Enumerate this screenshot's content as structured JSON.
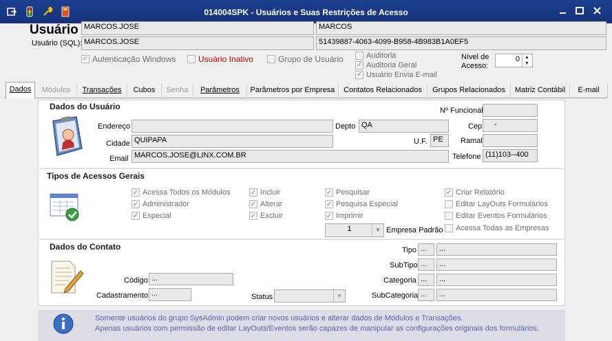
{
  "window": {
    "title": "014004SPK - Usuários e Suas Restrições de Acesso"
  },
  "header": {
    "usuario_label": "Usuário",
    "usuario_sql_label": "Usuário (SQL):",
    "login": "MARCOS.JOSE",
    "name": "MARCOS",
    "sql_login": "MARCOS.JOSE",
    "guid": "51439887-4063-4099-B958-4B983B1A0EF5",
    "auth_windows": "Autenticação Windows",
    "usuario_inativo": "Usuário Inativo",
    "grupo_usuario": "Grupo de Usuário",
    "auditoria": "Auditoria",
    "auditoria_geral": "Auditoria Geral",
    "usuario_envia_email": "Usuário Envia E-mail",
    "nivel_acesso_label_1": "Nível de",
    "nivel_acesso_label_2": "Acesso:",
    "nivel_acesso_value": "0"
  },
  "tabs": [
    {
      "label": "Dados"
    },
    {
      "label": "Módulos"
    },
    {
      "label": "Transações"
    },
    {
      "label": "Cubos"
    },
    {
      "label": "Senha"
    },
    {
      "label": "Parâmetros"
    },
    {
      "label": "Parâmetros por Empresa"
    },
    {
      "label": "Contatos Relacionados"
    },
    {
      "label": "Grupos Relacionados"
    },
    {
      "label": "Matriz Contábil"
    },
    {
      "label": "E-mail"
    }
  ],
  "dados_usuario": {
    "title": "Dados do Usuário",
    "n_funcional_label": "Nº Funcional",
    "endereco_label": "Endereço",
    "depto_label": "Depto",
    "depto_value": "QA",
    "cep_label": "Cep",
    "cep_value": "-",
    "cidade_label": "Cidade",
    "cidade_value": "QUIPAPA",
    "uf_label": "U.F.",
    "uf_value": "PE",
    "ramal_label": "Ramal",
    "email_label": "Email",
    "email_value": "MARCOS.JOSE@LINX.COM.BR",
    "telefone_label": "Telefone",
    "telefone_value": "(11)103--400"
  },
  "acessos": {
    "title": "Tipos de Acessos Gerais",
    "items": [
      "Acessa Todos os Módulos",
      "Administrador",
      "Especial",
      "Incluir",
      "Alterar",
      "Excluir",
      "Pesquisar",
      "Pesquisa Especial",
      "Imprimir",
      "Criar Relatório",
      "Editar LayOuts Formulários",
      "Editar Eventos Formulários",
      "Acessa Todas as Empresas"
    ],
    "empresa_padrao_value": "1",
    "empresa_padrao_label": "Empresa Padrão"
  },
  "contato": {
    "title": "Dados do Contato",
    "tipo_label": "Tipo",
    "subtipo_label": "SubTipo",
    "categoria_label": "Categoria",
    "subcategoria_label": "SubCategoria",
    "codigo_label": "Código",
    "cadastramento_label": "Cadastramento",
    "status_label": "Status",
    "ellipsis": "..."
  },
  "info": {
    "line1": "Somente usuários do grupo SysAdmin podem criar novos usuários e alterar dados de Módulos e Transações.",
    "line2": "Apenas usuários com permissão de editar LayOuts/Eventos serão capazes de manipular as configurações originais dos formulários."
  },
  "colors": {
    "titlebar": "#1c3f8e",
    "info_text": "#5a63b8",
    "inactive_red": "#c00000"
  }
}
